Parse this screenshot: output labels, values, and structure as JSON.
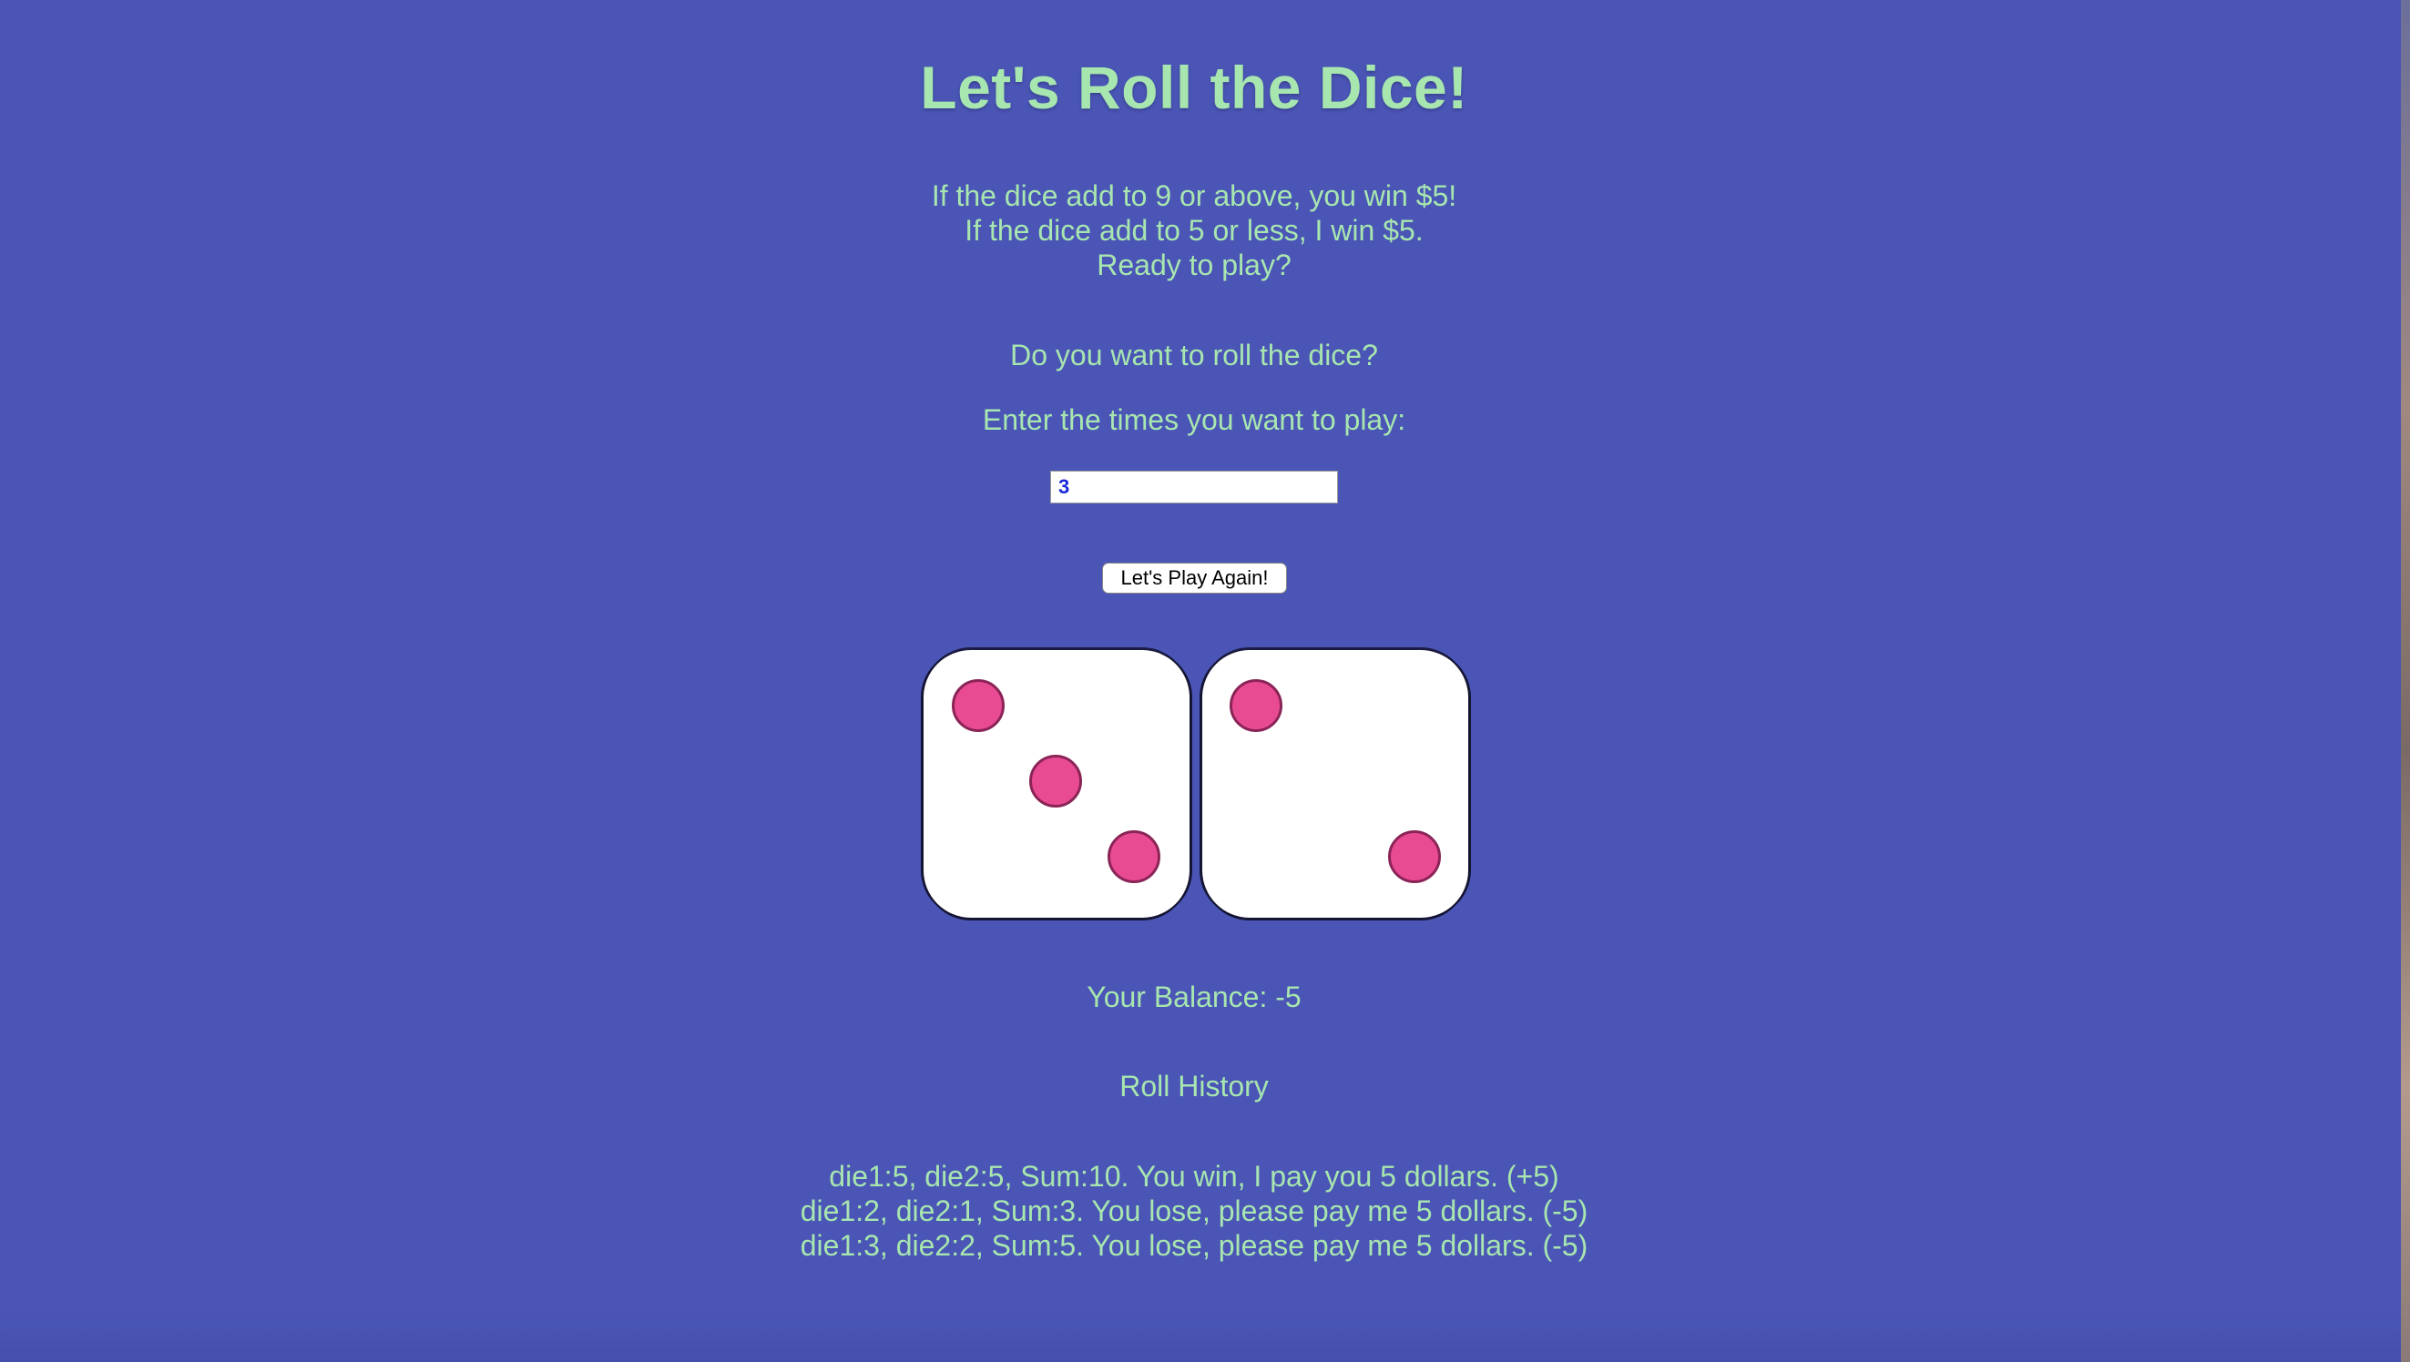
{
  "page": {
    "title": "Let's Roll the Dice!",
    "rules": [
      "If the dice add to 9 or above, you win $5!",
      "If the dice add to 5 or less, I win $5.",
      "Ready to play?"
    ],
    "question": "Do you want to roll the dice?",
    "prompt": "Enter the times you want to play:",
    "times_input_value": "3",
    "play_button_label": "Let's Play Again!",
    "dice": [
      {
        "value": 3
      },
      {
        "value": 2
      }
    ],
    "balance_text": "Your Balance: -5",
    "history_title": "Roll History",
    "history": [
      "die1:5, die2:5, Sum:10. You win, I pay you 5 dollars. (+5)",
      "die1:2, die2:1, Sum:3. You lose, please pay me 5 dollars. (-5)",
      "die1:3, die2:2, Sum:5. You lose, please pay me 5 dollars. (-5)"
    ]
  },
  "colors": {
    "background": "#4a55b5",
    "text": "#a8e6b0",
    "pip": "#e94b93",
    "pip_border": "#8b2456",
    "die_face": "#ffffff"
  }
}
